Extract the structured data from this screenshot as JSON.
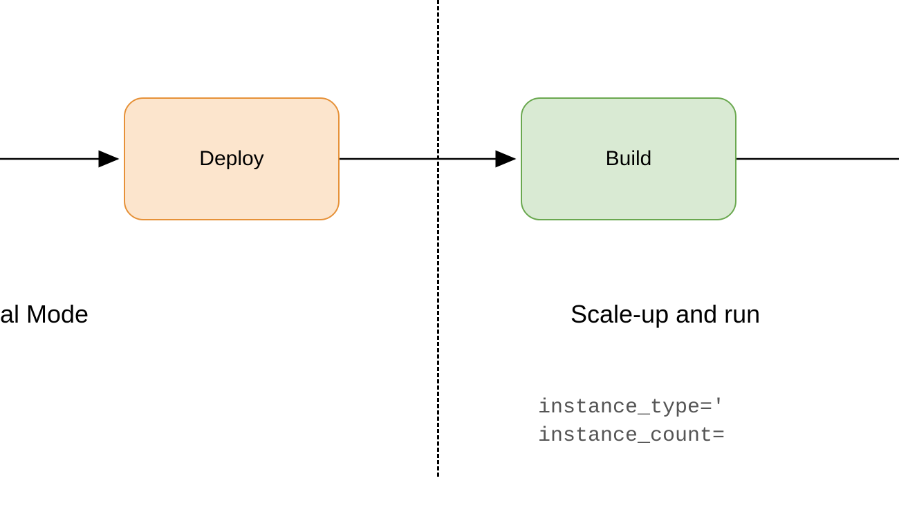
{
  "nodes": {
    "deploy": {
      "label": "Deploy"
    },
    "build": {
      "label": "Build"
    }
  },
  "sections": {
    "left": {
      "label": "al Mode"
    },
    "right": {
      "label": "Scale-up and run"
    }
  },
  "code": {
    "line1": "instance_type='",
    "line2": "instance_count="
  }
}
